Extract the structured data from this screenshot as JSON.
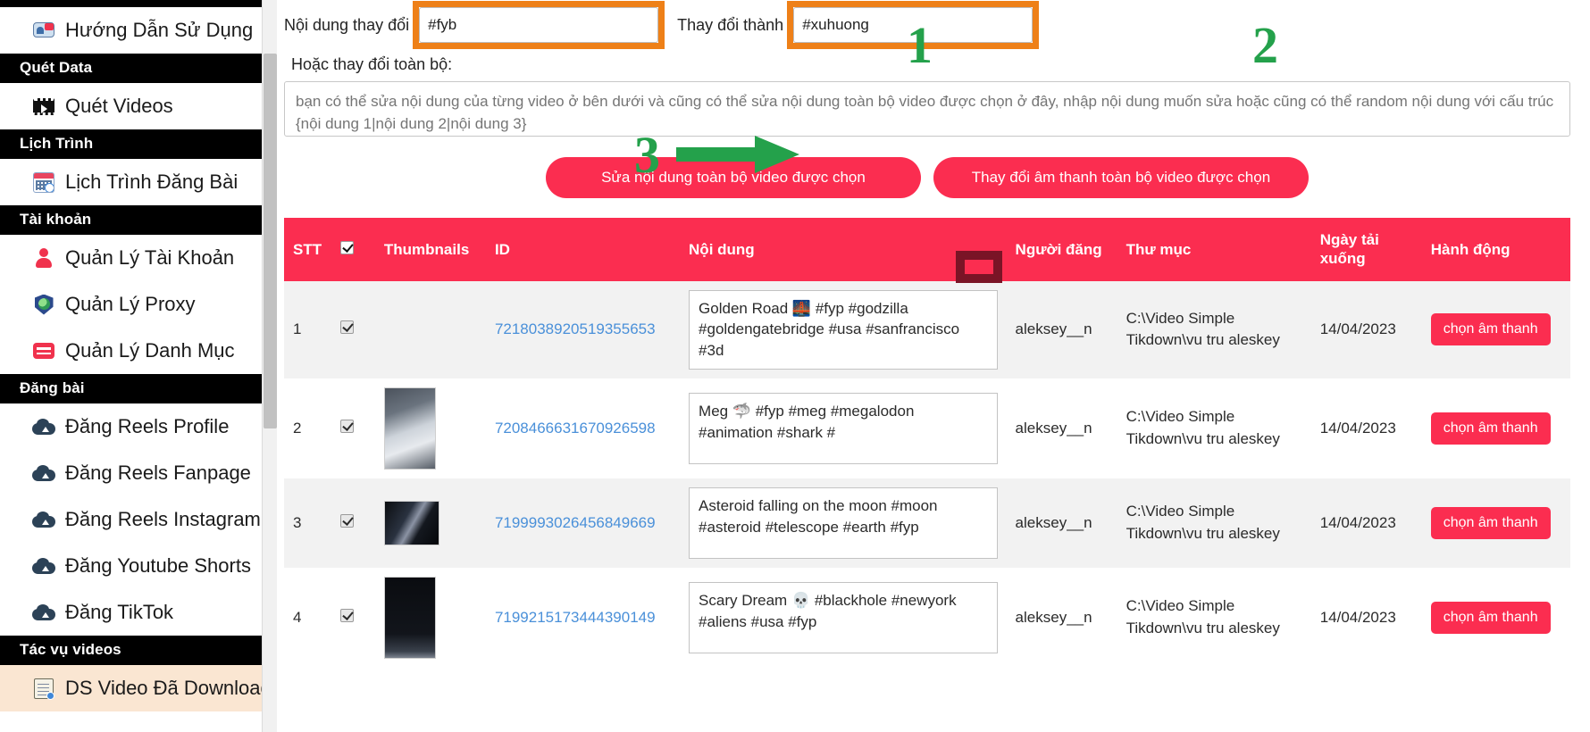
{
  "sidebar": {
    "groups": [
      {
        "section": null,
        "items": [
          {
            "label": "Hướng Dẫn Sử Dụng",
            "icon": "guide-icon",
            "name": "sidebar-item-huong-dan-su-dung",
            "active": false
          }
        ]
      },
      {
        "section": "Quét Data",
        "section_name": "sidebar-section-quet-data",
        "items": [
          {
            "label": "Quét Videos",
            "icon": "video-icon",
            "name": "sidebar-item-quet-videos",
            "active": false
          }
        ]
      },
      {
        "section": "Lịch Trình",
        "section_name": "sidebar-section-lich-trinh",
        "items": [
          {
            "label": "Lịch Trình Đăng Bài",
            "icon": "calendar-icon",
            "name": "sidebar-item-lich-trinh-dang-bai",
            "active": false
          }
        ]
      },
      {
        "section": "Tài khoản",
        "section_name": "sidebar-section-tai-khoan",
        "items": [
          {
            "label": "Quản Lý Tài Khoản",
            "icon": "user-icon",
            "name": "sidebar-item-quan-ly-tai-khoan",
            "active": false
          },
          {
            "label": "Quản Lý Proxy",
            "icon": "shield-icon",
            "name": "sidebar-item-quan-ly-proxy",
            "active": false
          },
          {
            "label": "Quản Lý Danh Mục",
            "icon": "list-icon",
            "name": "sidebar-item-quan-ly-danh-muc",
            "active": false
          }
        ]
      },
      {
        "section": "Đăng bài",
        "section_name": "sidebar-section-dang-bai",
        "items": [
          {
            "label": "Đăng Reels Profile",
            "icon": "cloud-upload-icon",
            "name": "sidebar-item-dang-reels-profile",
            "active": false
          },
          {
            "label": "Đăng Reels Fanpage",
            "icon": "cloud-upload-icon",
            "name": "sidebar-item-dang-reels-fanpage",
            "active": false
          },
          {
            "label": "Đăng Reels Instagram",
            "icon": "cloud-upload-icon",
            "name": "sidebar-item-dang-reels-instagram",
            "active": false
          },
          {
            "label": "Đăng Youtube Shorts",
            "icon": "cloud-upload-icon",
            "name": "sidebar-item-dang-youtube-shorts",
            "active": false
          },
          {
            "label": "Đăng TikTok",
            "icon": "cloud-upload-icon",
            "name": "sidebar-item-dang-tiktok",
            "active": false
          }
        ]
      },
      {
        "section": "Tác vụ videos",
        "section_name": "sidebar-section-tac-vu-videos",
        "items": [
          {
            "label": "DS Video Đã Download",
            "icon": "document-icon",
            "name": "sidebar-item-ds-video-da-download",
            "active": true
          }
        ]
      }
    ]
  },
  "form": {
    "find_label": "Nội dung thay đổi",
    "find_value": "#fyb",
    "replace_label": "Thay đổi thành",
    "replace_value": "#xuhuong",
    "bulk_label": "Hoặc thay đổi toàn bộ:",
    "bulk_placeholder": "bạn có thể sửa nội dung của từng video ở bên dưới và cũng có thể sửa nội dung toàn bộ video được chọn ở đây, nhập nội dung muốn sửa hoặc cũng có thể random nội dung với cấu trúc {nội dung 1|nội dung 2|nội dung 3}",
    "btn_edit_all": "Sửa nội dung toàn bộ video được chọn",
    "btn_audio_all": "Thay đổi âm thanh toàn bộ video được chọn"
  },
  "annotations": {
    "n1": "1",
    "n2": "2",
    "n3": "3",
    "highlight_color_orange": "#ee8018",
    "highlight_color_dark": "#7a1426",
    "arrow_color": "#24a14b"
  },
  "table": {
    "headers": {
      "stt": "STT",
      "check": "",
      "thumbnails": "Thumbnails",
      "id": "ID",
      "content": "Nội dung",
      "user": "Người đăng",
      "dir": "Thư mục",
      "date": "Ngày tải xuống",
      "action": "Hành động"
    },
    "rows": [
      {
        "stt": "1",
        "checked": true,
        "thumb": false,
        "thumb_class": "",
        "id": "7218038920519355653",
        "content": "Golden Road 🌉 #fyp #godzilla #goldengatebridge #usa #sanfrancisco #3d",
        "user": "aleksey__n",
        "dir": "C:\\Video Simple Tikdown\\vu tru aleskey",
        "date": "14/04/2023",
        "action": "chọn âm thanh"
      },
      {
        "stt": "2",
        "checked": true,
        "thumb": true,
        "thumb_class": "t2",
        "id": "7208466631670926598",
        "content": "Meg 🦈 #fyp #meg #megalodon #animation #shark #",
        "user": "aleksey__n",
        "dir": "C:\\Video Simple Tikdown\\vu tru aleskey",
        "date": "14/04/2023",
        "action": "chọn âm thanh"
      },
      {
        "stt": "3",
        "checked": true,
        "thumb": true,
        "thumb_class": "t3",
        "id": "7199993026456849669",
        "content": "Asteroid falling on the moon #moon #asteroid #telescope #earth #fyp",
        "user": "aleksey__n",
        "dir": "C:\\Video Simple Tikdown\\vu tru aleskey",
        "date": "14/04/2023",
        "action": "chọn âm thanh"
      },
      {
        "stt": "4",
        "checked": true,
        "thumb": true,
        "thumb_class": "t4",
        "id": "7199215173444390149",
        "content": "Scary Dream 💀 #blackhole #newyork #aliens #usa #fyp",
        "user": "aleksey__n",
        "dir": "C:\\Video Simple Tikdown\\vu tru aleskey",
        "date": "14/04/2023",
        "action": "chọn âm thanh"
      }
    ]
  }
}
